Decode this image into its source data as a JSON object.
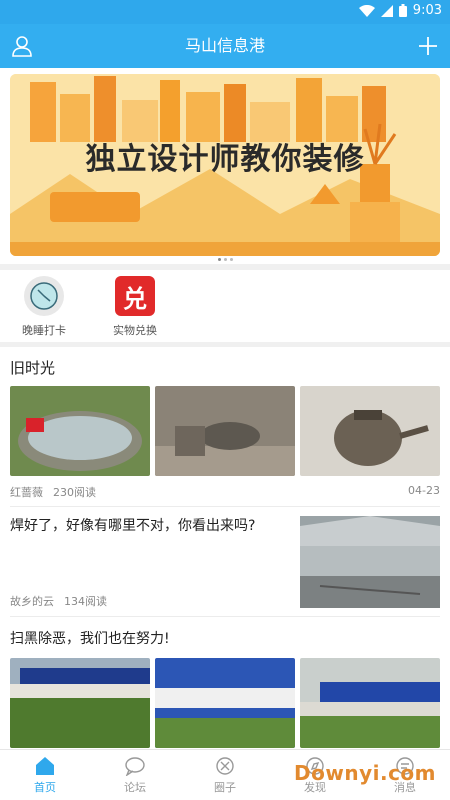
{
  "status_bar": {
    "time": "9:03",
    "icons": [
      "wifi-icon",
      "signal-icon",
      "battery-icon"
    ]
  },
  "app_bar": {
    "title": "马山信息港",
    "left_icon": "user-icon",
    "right_icon": "plus-icon"
  },
  "banner": {
    "text": "独立设计师教你装修",
    "accent": "#f2a531"
  },
  "quick_actions": [
    {
      "label": "晚睡打卡",
      "icon": "clock-icon"
    },
    {
      "label": "实物兑换",
      "icon": "exchange-icon"
    }
  ],
  "feed": {
    "post1": {
      "title": "旧时光",
      "author": "红蔷薇",
      "reads": "230阅读",
      "date": "04-23"
    },
    "post2": {
      "title": "焊好了，好像有哪里不对，你看出来吗?",
      "author": "故乡的云",
      "reads": "134阅读"
    },
    "post3": {
      "title": "扫黑除恶，我们也在努力!"
    }
  },
  "tabs": [
    {
      "label": "首页",
      "icon": "home-icon",
      "active": true
    },
    {
      "label": "论坛",
      "icon": "chat-icon",
      "active": false
    },
    {
      "label": "圈子",
      "icon": "circle-icon",
      "active": false
    },
    {
      "label": "发现",
      "icon": "compass-icon",
      "active": false
    },
    {
      "label": "消息",
      "icon": "message-icon",
      "active": false
    }
  ],
  "watermark": "Downyi.com",
  "colors": {
    "primary": "#33aef0",
    "active_tab": "#2fa8ec"
  }
}
